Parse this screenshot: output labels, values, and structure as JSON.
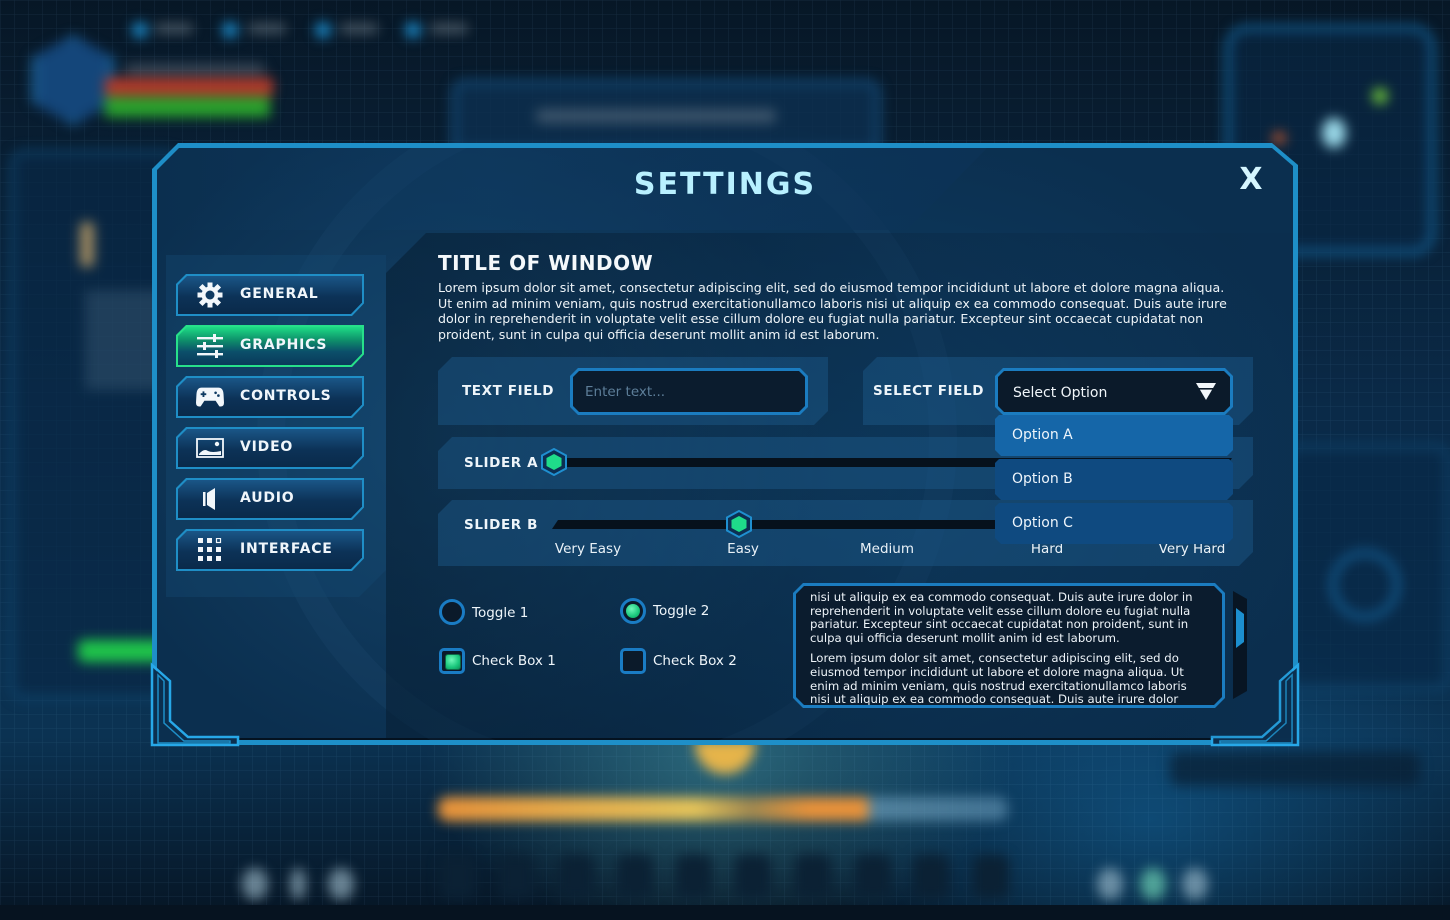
{
  "window": {
    "title": "SETTINGS",
    "close_label": "X"
  },
  "sidebar": {
    "items": [
      {
        "label": "GENERAL",
        "icon": "gear-icon",
        "active": false
      },
      {
        "label": "GRAPHICS",
        "icon": "sliders-icon",
        "active": true
      },
      {
        "label": "CONTROLS",
        "icon": "gamepad-icon",
        "active": false
      },
      {
        "label": "VIDEO",
        "icon": "image-icon",
        "active": false
      },
      {
        "label": "AUDIO",
        "icon": "speaker-icon",
        "active": false
      },
      {
        "label": "INTERFACE",
        "icon": "grid-icon",
        "active": false
      }
    ]
  },
  "content": {
    "title": "TITLE OF WINDOW",
    "description": "Lorem ipsum dolor sit amet, consectetur adipiscing elit, sed do eiusmod tempor incididunt ut labore et dolore magna aliqua. Ut enim ad minim veniam, quis nostrud exercitationullamco laboris nisi ut aliquip ex ea commodo consequat. Duis aute irure dolor in reprehenderit in voluptate velit esse cillum dolore eu fugiat nulla pariatur. Excepteur sint occaecat cupidatat non proident, sunt in culpa qui officia deserunt mollit anim id est laborum.",
    "text_field": {
      "label": "TEXT FIELD",
      "value": "",
      "placeholder": "Enter text..."
    },
    "select_field": {
      "label": "SELECT FIELD",
      "value": "Select Option",
      "open": true,
      "options": [
        "Option A",
        "Option B",
        "Option C"
      ],
      "highlighted_index": 0
    },
    "slider_a": {
      "label": "SLIDER A",
      "value": 0.0
    },
    "slider_b": {
      "label": "SLIDER B",
      "value": 0.25,
      "ticks": [
        "Very Easy",
        "Easy",
        "Medium",
        "Hard",
        "Very Hard"
      ],
      "selected_tick": "Easy"
    },
    "toggles": [
      {
        "label": "Toggle 1",
        "checked": false
      },
      {
        "label": "Toggle 2",
        "checked": true
      }
    ],
    "checkboxes": [
      {
        "label": "Check Box 1",
        "checked": true
      },
      {
        "label": "Check Box 2",
        "checked": false
      }
    ],
    "scroll_text": {
      "paragraphs": [
        "nisi ut aliquip ex ea commodo consequat. Duis aute irure dolor in reprehenderit in voluptate velit esse cillum dolore eu fugiat nulla pariatur. Excepteur sint occaecat cupidatat non proident, sunt in culpa qui officia deserunt mollit anim id est laborum.",
        "Lorem ipsum dolor sit amet, consectetur adipiscing elit, sed do eiusmod tempor incididunt ut labore et dolore magna aliqua. Ut enim ad minim veniam, quis nostrud exercitationullamco laboris nisi ut aliquip ex ea commodo consequat. Duis aute irure dolor"
      ],
      "scroll_position": 0.25
    }
  },
  "colors": {
    "accent_blue": "#1e8fc8",
    "accent_green": "#27e08a",
    "title_cyan": "#b8f0ff",
    "panel_dark": "#0b2f4f"
  }
}
